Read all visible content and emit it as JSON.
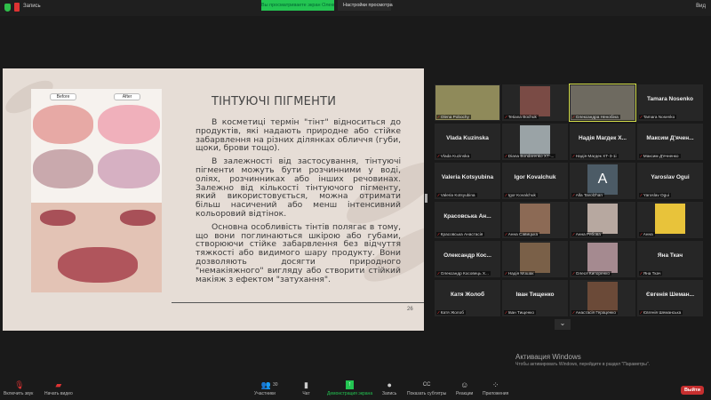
{
  "topbar": {
    "recording": "Запись",
    "viewing": "Вы просматриваете экран Олександра Ненобіна",
    "view_options": "Настройки просмотра",
    "view_button": "Вид"
  },
  "slide": {
    "title": "ТІНТУЮЧІ ПІГМЕНТИ",
    "before": "Before",
    "after": "After",
    "paragraphs": [
      "В косметиці термін \"тінт\" відноситься до продуктів, які надають природне або стійке забарвлення на різних ділянках обличчя (губи, щоки, брови тощо).",
      "В залежності від застосування, тінтуючі пігменти можуть бути розчинними у воді, оліях, розчинниках або інших речовинах. Залежно від кількості тінтуючого пігменту, який використовується, можна отримати більш насичений або менш інтенсивний кольоровий відтінок.",
      "Основна особливість тінтів полягає в тому, що вони поглинаються шкірою або губами, створюючи стійке забарвлення без відчуття тяжкості або видимого шару продукту. Вони дозволяють досягти природного \"немакіяжного\" вигляду або створити стійкий макіяж з ефектом \"затухання\"."
    ],
    "page": "26"
  },
  "participants": [
    {
      "name": "",
      "label": "Olena Pobochy",
      "video": true,
      "color": "#8f8a5a"
    },
    {
      "name": "",
      "label": "Tetiana Bochuk",
      "video": true,
      "color": "#7a4b45"
    },
    {
      "name": "",
      "label": "Олександра Ненобіна",
      "video": true,
      "color": "#6e6a60",
      "active": true
    },
    {
      "name": "Tamara Nosenko",
      "label": "Tamara Nosenko"
    },
    {
      "name": "Vlada Kuzinska",
      "label": "Vlada Kuzinska"
    },
    {
      "name": "",
      "label": "Diana Bondarenko ХТ-...",
      "video": true,
      "color": "#9aa3a6"
    },
    {
      "name": "Надія Магдек Х...",
      "label": "Надія Магдек ХТ-3-1і"
    },
    {
      "name": "Максим Д'ячен...",
      "label": "Максим Д'ячненко"
    },
    {
      "name": "Valeria Kotsyubina",
      "label": "Valeria Kotsyubina"
    },
    {
      "name": "Igor Kovalchuk",
      "label": "Igor Kovalchuk"
    },
    {
      "name": "",
      "label": "Alla Tavolzhan",
      "avatar": "A"
    },
    {
      "name": "Yaroslav Ogui",
      "label": "Yaroslav Ogui"
    },
    {
      "name": "Красовська Ан...",
      "label": "Красовська Анастасія"
    },
    {
      "name": "",
      "label": "Анна Савицька",
      "video": true,
      "color": "#8c6a55"
    },
    {
      "name": "",
      "label": "Анна Рябова",
      "video": true,
      "color": "#b7a8a0"
    },
    {
      "name": "",
      "label": "Анна",
      "video": true,
      "color": "#e8c33a"
    },
    {
      "name": "Олександр Кос...",
      "label": "Олександр Косовець Х..."
    },
    {
      "name": "",
      "label": "Надія Мошак",
      "video": true,
      "color": "#7a6048"
    },
    {
      "name": "",
      "label": "Олеся Кипоренко",
      "video": true,
      "color": "#a58a90"
    },
    {
      "name": "Яна Ткач",
      "label": "Яна Ткач"
    },
    {
      "name": "Катя Жолоб",
      "label": "Катя Жолоб"
    },
    {
      "name": "Іван Тищенко",
      "label": "Іван Тищенко"
    },
    {
      "name": "",
      "label": "Анастасія Гераценко",
      "video": true,
      "color": "#6b4a38"
    },
    {
      "name": "Євгенія Шеман...",
      "label": "Євгенія Шеманська"
    }
  ],
  "more_icon": "chevron-down-icon",
  "activation": {
    "title": "Активация Windows",
    "subtitle": "Чтобы активировать Windows, перейдите в раздел \"Параметры\"."
  },
  "toolbar": {
    "audio": "Включить звук",
    "video": "Начать видео",
    "participants": "Участники",
    "participants_count": "30",
    "chat": "Чат",
    "share": "Демонстрация экрана",
    "record": "Запись",
    "captions": "Показать субтитры",
    "reactions": "Реакции",
    "apps": "Приложения",
    "leave": "Выйти"
  }
}
